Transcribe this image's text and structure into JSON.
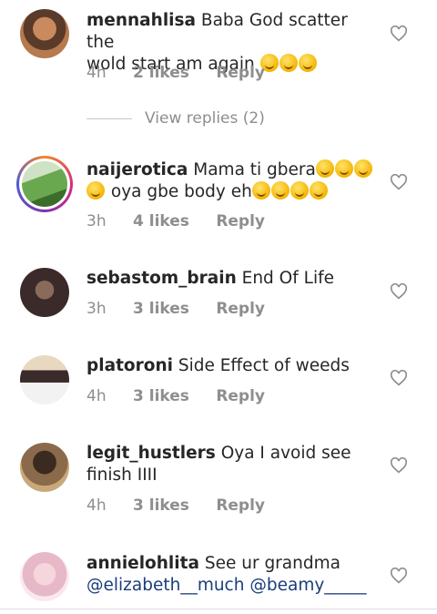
{
  "comments": [
    {
      "username": "mennahlisa",
      "text_line1": "Baba God scatter the",
      "text_line2": "wold start am again",
      "emoji_count": 3,
      "time": "4h",
      "likes": "2 likes",
      "reply": "Reply",
      "avatar_colors": [
        "#b57a4e",
        "#5a3b2a"
      ]
    },
    {
      "username": "naijerotica",
      "text_line1": "Mama ti gbera",
      "text_line2": "oya gbe body eh",
      "time": "3h",
      "likes": "4 likes",
      "reply": "Reply",
      "avatar_colors": [
        "#6aa84f",
        "#cfe2c3"
      ]
    },
    {
      "username": "sebastom_brain",
      "text_line1": "End Of Life",
      "time": "3h",
      "likes": "3 likes",
      "reply": "Reply",
      "avatar_colors": [
        "#3b2a2a",
        "#8a6a5a"
      ]
    },
    {
      "username": "platoroni",
      "text_line1": "Side Effect of weeds",
      "time": "4h",
      "likes": "3 likes",
      "reply": "Reply",
      "avatar_colors": [
        "#d9c4a8",
        "#2a2a4a"
      ]
    },
    {
      "username": "legit_hustlers",
      "text_line1": "Oya I avoid see",
      "text_line2": "finish IIII",
      "time": "4h",
      "likes": "3 likes",
      "reply": "Reply",
      "avatar_colors": [
        "#5a4030",
        "#c9a87a"
      ]
    },
    {
      "username": "annielohlita",
      "text_line1": "See ur grandma",
      "mention1": "@elizabeth__much",
      "mention2": "@beamy_____",
      "avatar_colors": [
        "#e6b8c8",
        "#c7a0b0"
      ]
    }
  ],
  "view_replies": "View replies (2)",
  "colors": {
    "text": "#262626",
    "muted": "#8e8e8e",
    "mention": "#1a3d7c"
  }
}
